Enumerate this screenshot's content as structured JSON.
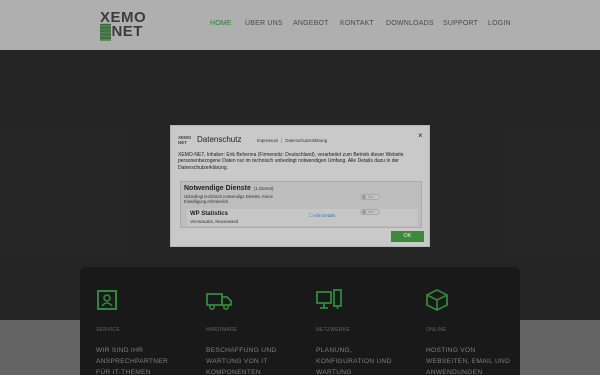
{
  "header": {
    "logo_line1": "XEMO",
    "logo_line2_mark": "▓",
    "logo_line2": "NET",
    "nav": [
      "HOME",
      "ÜBER UNS",
      "ANGEBOT",
      "KONTAKT",
      "DOWNLOADS",
      "SUPPORT",
      "LOGIN"
    ]
  },
  "colors": {
    "accent_green": "#2e9e3a",
    "icon_green": "#3aa84a",
    "ok_button": "#3a8a3a"
  },
  "services": [
    {
      "icon": "shield-icon",
      "category": "SERVICE",
      "lines": [
        "WIR SIND IHR",
        "ANSPRECHPARTNER",
        "FÜR IT-THEMEN"
      ]
    },
    {
      "icon": "truck-icon",
      "category": "HARDWARE",
      "lines": [
        "BESCHAFFUNG UND",
        "WARTUNG VON IT",
        "KOMPONENTEN"
      ]
    },
    {
      "icon": "network-icon",
      "category": "NETZWERKE",
      "lines": [
        "PLANUNG,",
        "KONFIGURATION UND",
        "WARTUNG"
      ]
    },
    {
      "icon": "box-icon",
      "category": "ONLINE",
      "lines": [
        "HOSTING VON",
        "WEBSEITEN, EMAIL UND",
        "ANWENDUNGEN"
      ]
    }
  ],
  "modal": {
    "logo_a": "XEMO",
    "logo_b": "NET",
    "title": "Datenschutz",
    "link_impressum": "Impressum",
    "link_sep": "|",
    "link_privacy": "Datenschutzerklärung",
    "close": "×",
    "intro": "XEMO-NET, Inhaber: Erik Behenna (Firmensitz: Deutschland), verarbeitet zum Betrieb dieser Website personenbezogene Daten nur im technisch unbedingt notwendigen Umfang. Alle Details dazu in der Datenschutzerklärung.",
    "group_title": "Notwendige Dienste",
    "group_count": "(1 Dienst)",
    "group_desc": "Unbedingt technisch notwendige Dienste. Keine Einwilligung erforderlich.",
    "toggle_label": "fest",
    "service_title": "WP Statistics",
    "service_desc": "VeronaLabs, Neuseeland",
    "service_link": "☐ Alle Details",
    "ok": "OK"
  }
}
